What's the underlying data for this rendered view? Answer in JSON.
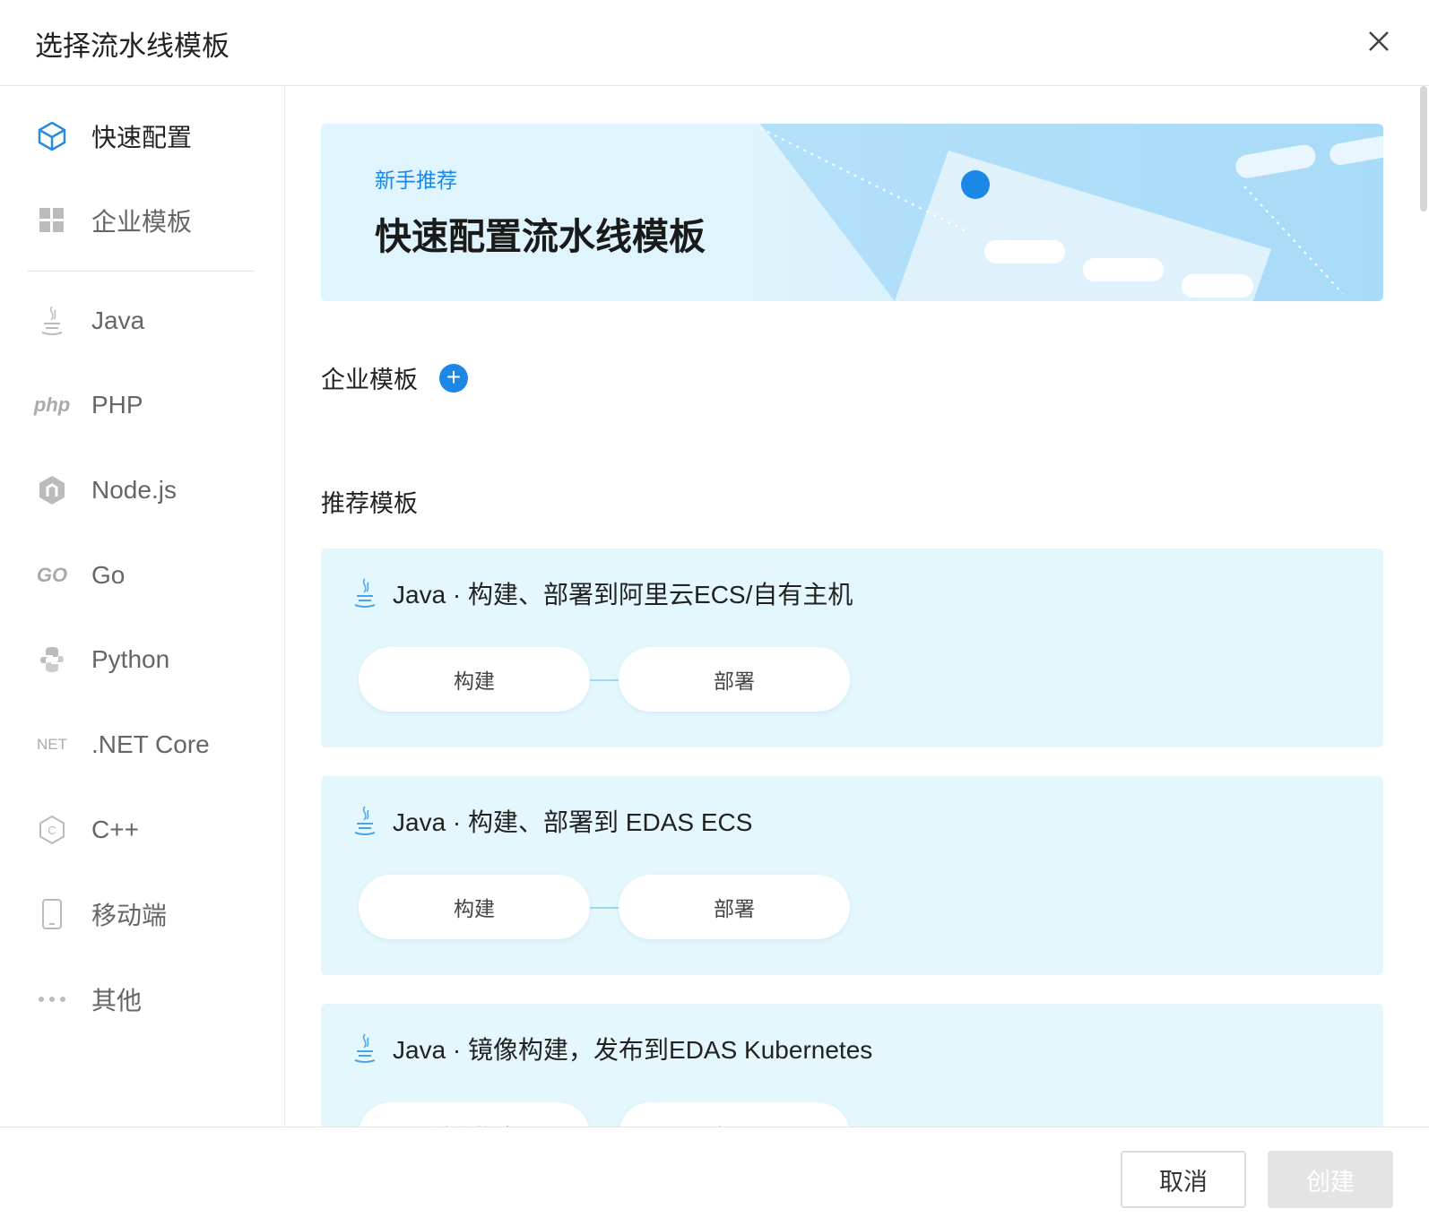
{
  "dialog": {
    "title": "选择流水线模板"
  },
  "sidebar": {
    "items": [
      {
        "label": "快速配置",
        "icon": "cube-icon",
        "active": true
      },
      {
        "label": "企业模板",
        "icon": "grid-icon"
      },
      {
        "label": "Java",
        "icon": "java-icon"
      },
      {
        "label": "PHP",
        "icon": "php-icon",
        "icon_text": "php"
      },
      {
        "label": "Node.js",
        "icon": "nodejs-icon"
      },
      {
        "label": "Go",
        "icon": "go-icon",
        "icon_text": "GO"
      },
      {
        "label": "Python",
        "icon": "python-icon"
      },
      {
        "label": ".NET Core",
        "icon": "dotnet-icon",
        "icon_text": "NET"
      },
      {
        "label": "C++",
        "icon": "cpp-icon"
      },
      {
        "label": "移动端",
        "icon": "mobile-icon"
      },
      {
        "label": "其他",
        "icon": "more-icon"
      }
    ]
  },
  "banner": {
    "subtitle": "新手推荐",
    "title": "快速配置流水线模板"
  },
  "enterprise": {
    "title": "企业模板"
  },
  "recommended": {
    "title": "推荐模板",
    "cards": [
      {
        "title": "Java · 构建、部署到阿里云ECS/自有主机",
        "stages": [
          "构建",
          "部署"
        ]
      },
      {
        "title": "Java · 构建、部署到 EDAS ECS",
        "stages": [
          "构建",
          "部署"
        ]
      },
      {
        "title": "Java · 镜像构建，发布到EDAS Kubernetes",
        "stages": [
          "镜像构建",
          "部署"
        ]
      }
    ]
  },
  "footer": {
    "cancel": "取消",
    "create": "创建"
  },
  "colors": {
    "accent": "#1b87e6",
    "card_bg": "#e3f7fd"
  }
}
